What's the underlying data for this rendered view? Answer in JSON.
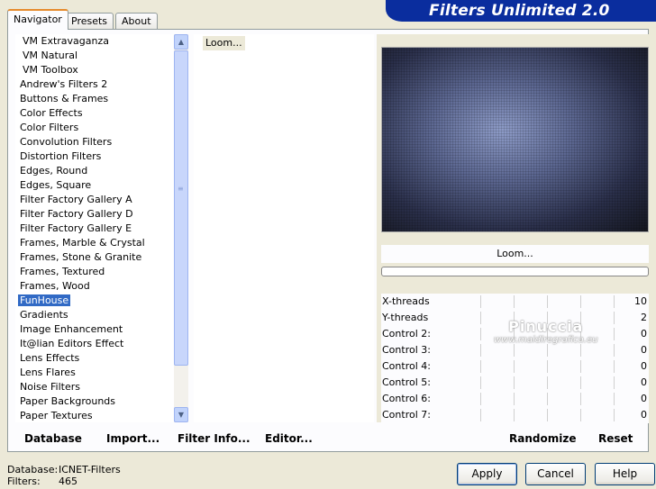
{
  "tabs": [
    "Navigator",
    "Presets",
    "About"
  ],
  "brand": "Filters Unlimited 2.0",
  "categories": [
    "VM Extravaganza",
    "VM Natural",
    "VM Toolbox",
    "Andrew's Filters 2",
    "Buttons & Frames",
    "Color Effects",
    "Color Filters",
    "Convolution Filters",
    "Distortion Filters",
    "Edges, Round",
    "Edges, Square",
    "Filter Factory Gallery A",
    "Filter Factory Gallery D",
    "Filter Factory Gallery E",
    "Frames, Marble & Crystal",
    "Frames, Stone & Granite",
    "Frames, Textured",
    "Frames, Wood",
    "FunHouse",
    "Gradients",
    "Image Enhancement",
    "It@lian Editors Effect",
    "Lens Effects",
    "Lens Flares",
    "Noise Filters",
    "Paper Backgrounds",
    "Paper Textures"
  ],
  "selected_category": "FunHouse",
  "filter_item": "Loom...",
  "filter_name": "Loom...",
  "controls": [
    {
      "label": "X-threads",
      "value": "10"
    },
    {
      "label": "Y-threads",
      "value": "2"
    },
    {
      "label": "Control 2:",
      "value": "0"
    },
    {
      "label": "Control 3:",
      "value": "0"
    },
    {
      "label": "Control 4:",
      "value": "0"
    },
    {
      "label": "Control 5:",
      "value": "0"
    },
    {
      "label": "Control 6:",
      "value": "0"
    },
    {
      "label": "Control 7:",
      "value": "0"
    }
  ],
  "watermark": {
    "line1": "Pinuccia",
    "line2": "www.maidiregrafica.eu"
  },
  "actions": {
    "database": "Database",
    "import": "Import...",
    "filter_info": "Filter Info...",
    "editor": "Editor...",
    "randomize": "Randomize",
    "reset": "Reset"
  },
  "status": {
    "database_label": "Database:",
    "database_value": "ICNET-Filters",
    "filters_label": "Filters:",
    "filters_value": "465"
  },
  "buttons": {
    "apply": "Apply",
    "cancel": "Cancel",
    "help": "Help"
  }
}
